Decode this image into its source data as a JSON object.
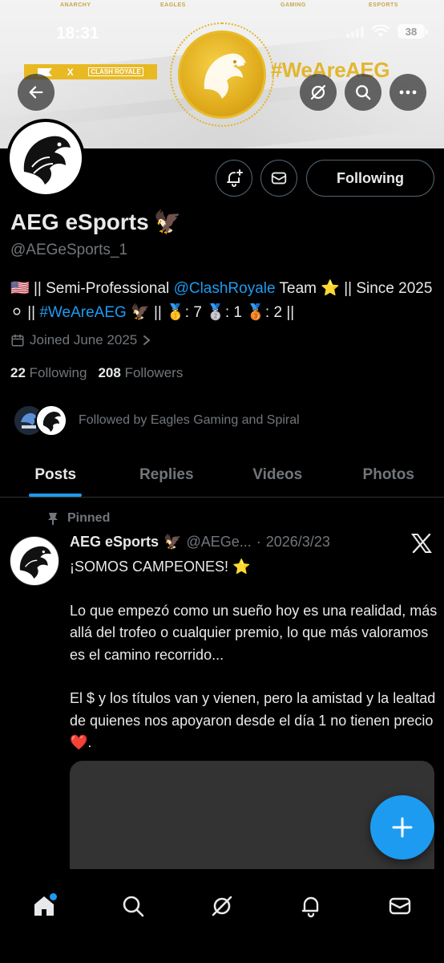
{
  "status_bar": {
    "time": "18:31",
    "battery": "38"
  },
  "banner": {
    "sponsors": [
      "ANARCHY",
      "EAGLES",
      "GAMING",
      "ESPORTS"
    ],
    "hashtag": "#WeAreAEG",
    "bar_x": "X",
    "bar_badge": "CLASH ROYALE"
  },
  "profile": {
    "name": "AEG eSports",
    "name_emoji": "🦅",
    "handle": "@AEGeSports_1",
    "bio": {
      "flag": "🇺🇸",
      "part1": " || Semi-Professional ",
      "mention": "@ClashRoyale",
      "part2": " Team ⭐ || Since 2025 ⚪ || ",
      "hashtag": "#WeAreAEG",
      "part3": " 🦅 || 🥇: 7 🥈: 1 🥉: 2 ||"
    },
    "joined": "Joined June 2025",
    "following_count": "22",
    "following_label": "Following",
    "followers_count": "208",
    "followers_label": "Followers",
    "followed_by": "Followed by Eagles Gaming and Spiral",
    "following_button": "Following"
  },
  "tabs": [
    {
      "label": "Posts",
      "active": true
    },
    {
      "label": "Replies",
      "active": false
    },
    {
      "label": "Videos",
      "active": false
    },
    {
      "label": "Photos",
      "active": false
    }
  ],
  "post": {
    "pinned_label": "Pinned",
    "author": "AEG eSports",
    "author_emoji": "🦅",
    "handle": "@AEGe...",
    "separator": "·",
    "date": "2026/3/23",
    "line1": "¡SOMOS CAMPEONES! ⭐",
    "para1": "Lo que empezó como un sueño hoy es una realidad, más allá del trofeo o cualquier premio, lo que más valoramos es el camino recorrido...",
    "para2": "El $ y los títulos van y vienen, pero la amistad y la lealtad de quienes nos apoyaron desde el día 1 no tienen precio ❤️."
  },
  "colors": {
    "accent": "#1d9bf0",
    "muted": "#71767b",
    "text": "#e7e9ea",
    "gold": "#e2b425",
    "border": "#2f3336"
  },
  "icons": {
    "back": "arrow-left-icon",
    "grok": "grok-icon",
    "search": "search-icon",
    "more": "more-icon",
    "notify": "bell-plus-icon",
    "message": "envelope-icon",
    "calendar": "calendar-icon",
    "pin": "pin-icon",
    "x": "x-logo-icon",
    "compose": "plus-icon",
    "home": "home-icon",
    "notifications": "bell-icon"
  }
}
